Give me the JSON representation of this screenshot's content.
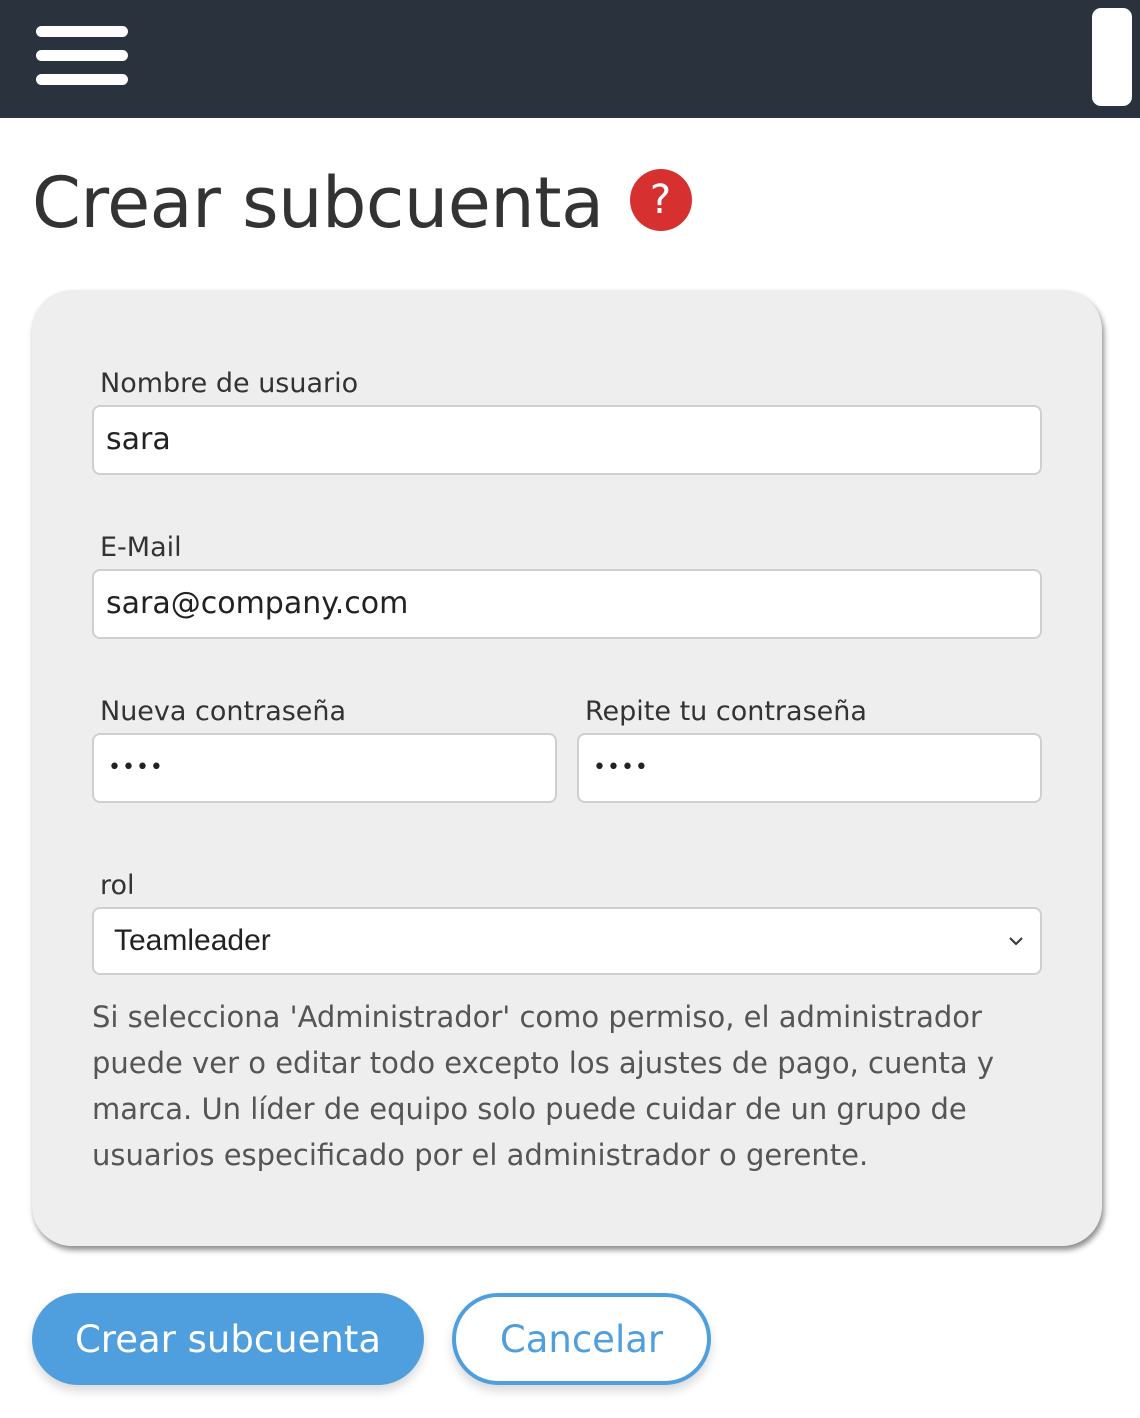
{
  "topbar": {
    "menu_icon": "hamburger-menu-icon",
    "background_color": "#2a323e"
  },
  "page": {
    "title": "Crear subcuenta",
    "help_icon_glyph": "?",
    "help_icon_color": "#d63031"
  },
  "form": {
    "username": {
      "label": "Nombre de usuario",
      "value": "sara"
    },
    "email": {
      "label": "E-Mail",
      "value": "sara@company.com"
    },
    "new_password": {
      "label": "Nueva contraseña",
      "value": "••••"
    },
    "repeat_password": {
      "label": "Repite tu contraseña",
      "value": "••••"
    },
    "role": {
      "label": "rol",
      "selected": "Teamleader"
    },
    "help_text": "Si selecciona 'Administrador' como permiso, el administrador puede ver o editar todo excepto los ajustes de pago, cuenta y marca. Un líder de equipo solo puede cuidar de un grupo de usuarios especificado por el administrador o gerente."
  },
  "actions": {
    "create_label": "Crear subcuenta",
    "cancel_label": "Cancelar",
    "accent_color": "#4f9fdf"
  }
}
